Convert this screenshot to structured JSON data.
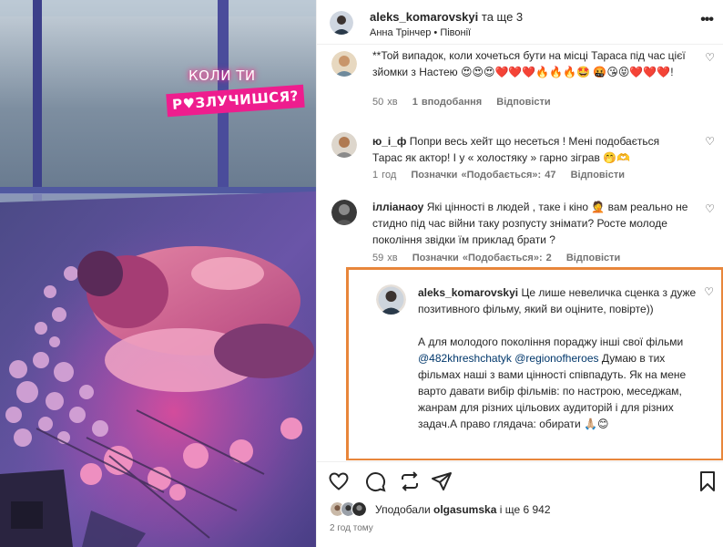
{
  "sticker": {
    "line1": "КОЛИ ТИ",
    "line2": "Р♥ЗЛУЧИШСЯ?"
  },
  "header": {
    "username": "aleks_komarovskyi",
    "coauthors": "та ще 3",
    "subtitle": "Анна Трінчер • Півонії",
    "more": "•••"
  },
  "comments": [
    {
      "username": "",
      "text": "**Той випадок, коли хочеться бути на місці Тараса під час цієї зйомки з Настею 😍😍😍❤️❤️❤️🔥🔥🔥🤩 🤬😘😝❤️❤️❤️!",
      "time": "50 хв",
      "likes": "1 вподобання",
      "reply": "Відповісти"
    },
    {
      "username": "ю_і_ф",
      "text": "Попри весь хейт що несеться ! Мені подобається Тарас як актор! І у « холостяку » гарно зіграв 🤭🫶",
      "time": "1 год",
      "likes": "Позначки «Подобається»: 47",
      "reply": "Відповісти"
    },
    {
      "username": "ілліанаоу",
      "text": "Які цінності в людей , таке і кіно 🤦 вам реально не стидно під час війни таку розпусту знімати? Росте молоде покоління звідки їм приклад брати ?",
      "time": "59 хв",
      "likes": "Позначки «Подобається»: 2",
      "reply": "Відповісти"
    }
  ],
  "reply": {
    "username": "aleks_komarovskyi",
    "text1": "Це лише невеличка сценка з дуже позитивного фільму, який ви оціните, повірте))",
    "text2": "А для молодого покоління пораджу інші свої фільми",
    "mention1": "@482khreshchatyk",
    "mention2": "@regionofheroes",
    "text3": "Думаю в тих фільмах наші з вами цінності співпадуть. Як на мене варто давати вибір фільмів: по настрою, меседжам, жанрам для різних цільових аудиторій і для різних задач.А право глядача: обирати 🙏🏼😊"
  },
  "likes": {
    "prefix": "Уподобали",
    "user": "olgasumska",
    "rest": "і ще 6 942"
  },
  "time": "2 год тому",
  "colors": {
    "highlight_border": "#e8863b",
    "link": "#00376b",
    "muted": "#737373"
  },
  "icons": [
    "heart-icon",
    "comment-icon",
    "share-icon",
    "send-icon",
    "bookmark-icon"
  ]
}
